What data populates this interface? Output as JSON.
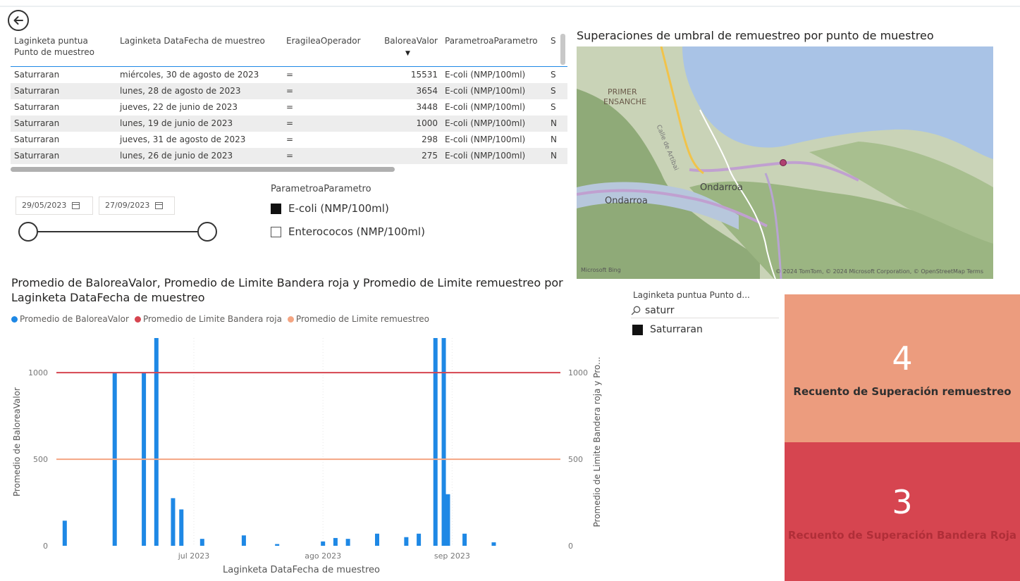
{
  "table": {
    "headers": [
      "Laginketa puntua Punto de muestreo",
      "Laginketa DataFecha de muestreo",
      "EragileaOperador",
      "BaloreaValor",
      "ParametroaParametro",
      "S"
    ],
    "rows": [
      {
        "punto": "Saturraran",
        "fecha": "miércoles, 30 de agosto de 2023",
        "operador": "=",
        "valor": "15531",
        "parametro": "E-coli (NMP/100ml)",
        "extra": "S"
      },
      {
        "punto": "Saturraran",
        "fecha": "lunes, 28 de agosto de 2023",
        "operador": "=",
        "valor": "3654",
        "parametro": "E-coli (NMP/100ml)",
        "extra": "S"
      },
      {
        "punto": "Saturraran",
        "fecha": "jueves, 22 de junio de 2023",
        "operador": "=",
        "valor": "3448",
        "parametro": "E-coli (NMP/100ml)",
        "extra": "S"
      },
      {
        "punto": "Saturraran",
        "fecha": "lunes, 19 de junio de 2023",
        "operador": "=",
        "valor": "1000",
        "parametro": "E-coli (NMP/100ml)",
        "extra": "N"
      },
      {
        "punto": "Saturraran",
        "fecha": "jueves, 31 de agosto de 2023",
        "operador": "=",
        "valor": "298",
        "parametro": "E-coli (NMP/100ml)",
        "extra": "N"
      },
      {
        "punto": "Saturraran",
        "fecha": "lunes, 26 de junio de 2023",
        "operador": "=",
        "valor": "275",
        "parametro": "E-coli (NMP/100ml)",
        "extra": "N"
      }
    ]
  },
  "date_slicer": {
    "start": "29/05/2023",
    "end": "27/09/2023",
    "start_fraction": 0.0,
    "end_fraction": 1.0
  },
  "param_slicer": {
    "title": "ParametroaParametro",
    "items": [
      {
        "label": "E-coli (NMP/100ml)",
        "checked": true
      },
      {
        "label": "Enterococos (NMP/100ml)",
        "checked": false
      }
    ]
  },
  "map": {
    "title": "Superaciones de umbral de remuestreo por punto de muestreo",
    "labels": [
      "PRIMER",
      "ENSANCHE",
      "Ondarroa",
      "Ondarroa",
      "Calle de Artibai"
    ],
    "copyright": "© 2024 TomTom, © 2024 Microsoft Corporation, © OpenStreetMap  Terms",
    "logo": "Microsoft Bing"
  },
  "chart": {
    "title": "Promedio de BaloreaValor, Promedio de Limite Bandera roja y Promedio de Limite remuestreo por Laginketa DataFecha de muestreo",
    "legend": [
      "Promedio de BaloreaValor",
      "Promedio de Limite Bandera roja",
      "Promedio de Limite remuestreo"
    ]
  },
  "chart_data": {
    "type": "bar",
    "title": "Promedio de BaloreaValor, Promedio de Limite Bandera roja y Promedio de Limite remuestreo por Laginketa DataFecha de muestreo",
    "xlabel": "Laginketa DataFecha de muestreo",
    "ylabel": "Promedio de BaloreaValor",
    "y2label": "Promedio de Limite Bandera roja y Pro...",
    "ylim": [
      0,
      1200
    ],
    "yticks": [
      0,
      500,
      1000
    ],
    "y2ticks": [
      0,
      500,
      1000
    ],
    "xlim": [
      "2023-05-29",
      "2023-09-27"
    ],
    "xticks": [
      {
        "date": "2023-07-01",
        "label": "jul 2023"
      },
      {
        "date": "2023-08-01",
        "label": "ago 2023"
      },
      {
        "date": "2023-09-01",
        "label": "sep 2023"
      }
    ],
    "grid": true,
    "legend_position": "top-left",
    "series": [
      {
        "name": "Promedio de BaloreaValor",
        "color": "#1e88e5",
        "type": "bar",
        "points": [
          {
            "x": "2023-05-31",
            "y": 145
          },
          {
            "x": "2023-06-12",
            "y": 1000
          },
          {
            "x": "2023-06-19",
            "y": 1000
          },
          {
            "x": "2023-06-22",
            "y": 3448
          },
          {
            "x": "2023-06-26",
            "y": 275
          },
          {
            "x": "2023-06-28",
            "y": 210
          },
          {
            "x": "2023-07-03",
            "y": 40
          },
          {
            "x": "2023-07-13",
            "y": 60
          },
          {
            "x": "2023-07-21",
            "y": 10
          },
          {
            "x": "2023-08-01",
            "y": 25
          },
          {
            "x": "2023-08-04",
            "y": 45
          },
          {
            "x": "2023-08-07",
            "y": 40
          },
          {
            "x": "2023-08-14",
            "y": 70
          },
          {
            "x": "2023-08-21",
            "y": 50
          },
          {
            "x": "2023-08-24",
            "y": 70
          },
          {
            "x": "2023-08-28",
            "y": 3654
          },
          {
            "x": "2023-08-30",
            "y": 15531
          },
          {
            "x": "2023-08-31",
            "y": 298
          },
          {
            "x": "2023-09-04",
            "y": 70
          },
          {
            "x": "2023-09-11",
            "y": 20
          }
        ]
      },
      {
        "name": "Promedio de Limite Bandera roja",
        "color": "#d64550",
        "type": "line",
        "value": 1000
      },
      {
        "name": "Promedio de Limite remuestreo",
        "color": "#f4a582",
        "type": "line",
        "value": 500
      }
    ]
  },
  "punto_slicer": {
    "title": "Laginketa puntua Punto d...",
    "search": "saturr",
    "item": "Saturraran"
  },
  "cards": [
    {
      "value": "4",
      "label": "Recuento de Superación remuestreo",
      "color": "#ec9c7e"
    },
    {
      "value": "3",
      "label": "Recuento de Superación Bandera Roja",
      "color": "#d64550"
    }
  ]
}
